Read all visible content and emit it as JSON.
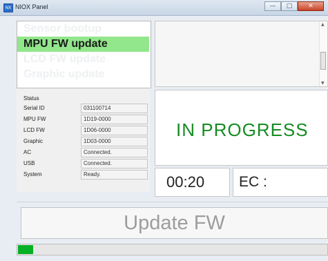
{
  "window": {
    "title": "NIOX Panel",
    "app_icon": "NX"
  },
  "modes": {
    "items": [
      {
        "label": "Sensor bootup",
        "selected": false
      },
      {
        "label": "MPU FW update",
        "selected": true
      },
      {
        "label": "LCD FW update",
        "selected": false
      },
      {
        "label": "Graphic update",
        "selected": false
      }
    ]
  },
  "status": {
    "title": "Status",
    "rows": [
      {
        "label": "Serial ID",
        "value": "031100714"
      },
      {
        "label": "MPU FW",
        "value": "1D19-0000"
      },
      {
        "label": "LCD FW",
        "value": "1D06-0000"
      },
      {
        "label": "Graphic",
        "value": "1D03-0000"
      },
      {
        "label": "AC",
        "value": "Connected."
      },
      {
        "label": "USB",
        "value": "Connected."
      },
      {
        "label": "System",
        "value": "Ready."
      }
    ]
  },
  "process": {
    "state": "IN PROGRESS",
    "timer": "00:20",
    "ec": "EC :"
  },
  "update_button": {
    "label": "Update FW"
  },
  "progress": {
    "fraction": 0.05
  },
  "colors": {
    "selected_bg": "#92e68b",
    "state_text": "#158b22",
    "progress_fill": "#06b025"
  }
}
